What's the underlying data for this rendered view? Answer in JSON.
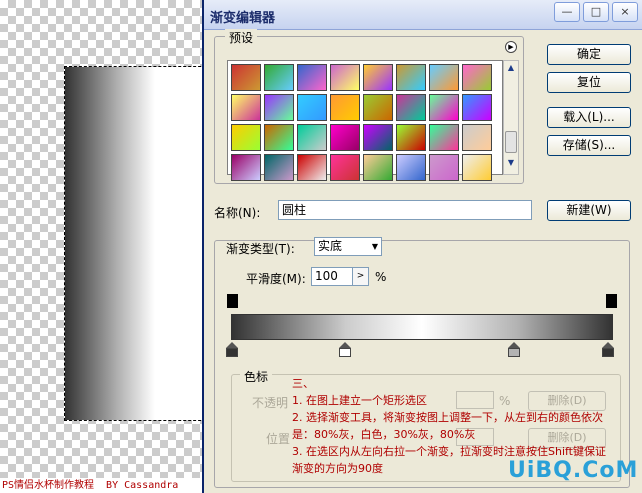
{
  "dialog": {
    "title": "渐变编辑器",
    "window_buttons": [
      "—",
      "□",
      "×"
    ],
    "presets_label": "预设",
    "buttons": {
      "ok": "确定",
      "reset": "复位",
      "load": "载入(L)...",
      "save": "存储(S)...",
      "new": "新建(W)"
    },
    "name_label": "名称(N):",
    "name_value": "圆柱",
    "gradient_type_label": "渐变类型(T):",
    "gradient_type_value": "实底",
    "smoothness_label": "平滑度(M):",
    "smoothness_value": "100",
    "smoothness_unit": "%",
    "color_stops_label": "色标",
    "dim_labels": {
      "opacity": "不透明",
      "location": "位置",
      "delete": "删除(D)"
    },
    "dim_percent": "%"
  },
  "swatches": [
    "#c33",
    "#3a3",
    "#36c",
    "#c6c",
    "#fc3",
    "#c93",
    "#6cf",
    "#f6c",
    "#ff6",
    "#93f",
    "#3cf",
    "#f93",
    "#9c3",
    "#c39",
    "#6f9",
    "#39f",
    "#fc0",
    "#c60",
    "#0c9",
    "#f0c",
    "#c0f",
    "#9f3",
    "#3f9",
    "#ccc",
    "#906",
    "#066",
    "#c00",
    "#f39",
    "#fc9",
    "#ccf",
    "#c9c",
    "#eee"
  ],
  "note": {
    "heading": "三、",
    "lines": [
      "1. 在图上建立一个矩形选区",
      "2. 选择渐变工具，将渐变按图上调整一下，从左到右的颜色依次",
      "是：80%灰，白色，30%灰，80%灰",
      "3. 在选区内从左向右拉一个渐变，拉渐变时注意按住Shift键保证",
      "渐变的方向为90度"
    ]
  },
  "footer": {
    "left": "PS情侣水杯制作教程",
    "right": "BY Cassandra"
  },
  "watermark": "UiBQ.CoM",
  "gradient_stops": [
    0.8,
    0.0,
    0.3,
    0.8
  ]
}
